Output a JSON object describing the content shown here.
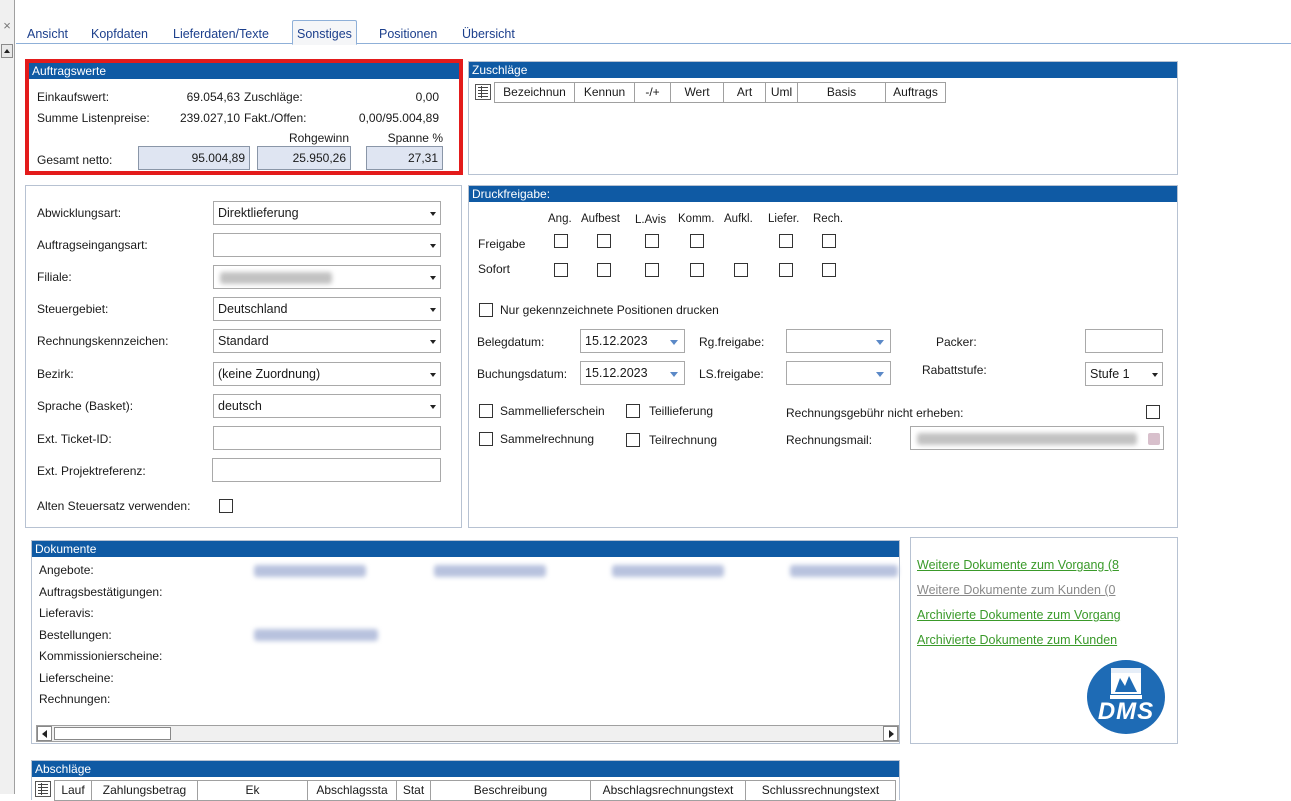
{
  "window": {
    "close_glyph": "×",
    "tabs": [
      {
        "label": "Ansicht",
        "active": false
      },
      {
        "label": "Kopfdaten",
        "active": false
      },
      {
        "label": "Lieferdaten/Texte",
        "active": false
      },
      {
        "label": "Sonstiges",
        "active": true
      },
      {
        "label": "Positionen",
        "active": false
      },
      {
        "label": "Übersicht",
        "active": false
      }
    ]
  },
  "auftragswerte": {
    "title": "Auftragswerte",
    "einkaufswert_label": "Einkaufswert:",
    "einkaufswert_value": "69.054,63",
    "zuschlaege_label": "Zuschläge:",
    "zuschlaege_value": "0,00",
    "listenpreise_label": "Summe Listenpreise:",
    "listenpreise_value": "239.027,10",
    "fakt_offen_label": "Fakt./Offen:",
    "fakt_offen_value": "0,00/95.004,89",
    "rohgewinn_label": "Rohgewinn",
    "spanne_label": "Spanne %",
    "gesamt_netto_label": "Gesamt netto:",
    "gesamt_netto_value": "95.004,89",
    "rohgewinn_value": "25.950,26",
    "spanne_value": "27,31",
    "highlight_color": "#e31b1b"
  },
  "zuschlaege": {
    "title": "Zuschläge",
    "columns": [
      "Bezeichnun",
      "Kennun",
      "-/+",
      "Wert",
      "Art",
      "Uml",
      "Basis",
      "Auftrags"
    ]
  },
  "abwicklung": {
    "fields": [
      {
        "label": "Abwicklungsart:",
        "value": "Direktlieferung"
      },
      {
        "label": "Auftragseingangsart:",
        "value": ""
      },
      {
        "label": "Filiale:",
        "value": ""
      },
      {
        "label": "Steuergebiet:",
        "value": "Deutschland"
      },
      {
        "label": "Rechnungskennzeichen:",
        "value": "Standard"
      },
      {
        "label": "Bezirk:",
        "value": "(keine Zuordnung)"
      },
      {
        "label": "Sprache (Basket):",
        "value": "deutsch"
      }
    ],
    "ticket_label": "Ext. Ticket-ID:",
    "ticket_value": "",
    "projekt_label": "Ext. Projektreferenz:",
    "projekt_value": "",
    "alter_steuersatz_label": "Alten Steuersatz verwenden:"
  },
  "druckfreigabe": {
    "title": "Druckfreigabe:",
    "columns": [
      "Ang.",
      "Aufbest",
      "L.Avis",
      "Komm.",
      "Aufkl.",
      "Liefer.",
      "Rech."
    ],
    "row_freigabe": "Freigabe",
    "row_sofort": "Sofort",
    "nur_gekennzeichnete": "Nur gekennzeichnete Positionen drucken",
    "belegdatum_label": "Belegdatum:",
    "belegdatum_value": "15.12.2023",
    "buchungsdatum_label": "Buchungsdatum:",
    "buchungsdatum_value": "15.12.2023",
    "rg_freigabe_label": "Rg.freigabe:",
    "ls_freigabe_label": "LS.freigabe:",
    "packer_label": "Packer:",
    "packer_value": "",
    "rabattstufe_label": "Rabattstufe:",
    "rabattstufe_value": "Stufe 1",
    "sammellieferschein": "Sammellieferschein",
    "teillieferung": "Teillieferung",
    "sammelrechnung": "Sammelrechnung",
    "teilrechnung": "Teilrechnung",
    "rechnungsgebuehr_label": "Rechnungsgebühr nicht erheben:",
    "rechnungsmail_label": "Rechnungsmail:"
  },
  "dokumente": {
    "title": "Dokumente",
    "rows": [
      "Angebote:",
      "Auftragsbestätigungen:",
      "Lieferavis:",
      "Bestellungen:",
      "Kommissionierscheine:",
      "Lieferscheine:",
      "Rechnungen:"
    ],
    "links": [
      {
        "label": "Weitere Dokumente zum Vorgang (8",
        "color": "#3a9a2a"
      },
      {
        "label": "Weitere Dokumente zum Kunden (0",
        "color": "#8a8a8a"
      },
      {
        "label": "Archivierte Dokumente zum Vorgang",
        "color": "#3a9a2a"
      },
      {
        "label": "Archivierte Dokumente zum Kunden",
        "color": "#3a9a2a"
      }
    ],
    "logo_text": "DMS"
  },
  "abschlaege": {
    "title": "Abschläge",
    "columns": [
      "Lauf",
      "Zahlungsbetrag",
      "Ek",
      "Abschlagssta",
      "Stat",
      "Beschreibung",
      "Abschlagsrechnungstext",
      "Schlussrechnungstext"
    ]
  },
  "colors": {
    "header_blue": "#0f5aa4",
    "tab_text": "#1c3f8c",
    "value_box": "#dfe5f2"
  }
}
